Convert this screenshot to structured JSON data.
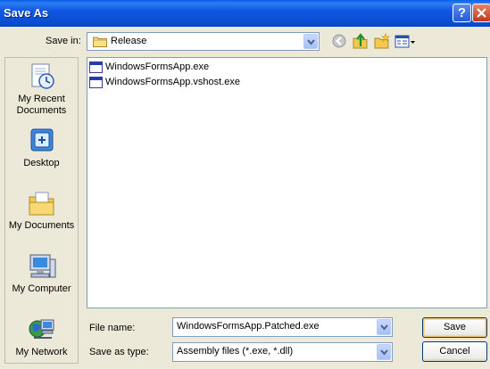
{
  "titlebar": {
    "title": "Save As",
    "help": "?"
  },
  "save_in": {
    "label": "Save in:",
    "value": "Release"
  },
  "toolbar": {
    "icons": [
      "back-icon",
      "up-one-level-icon",
      "new-folder-icon",
      "views-menu-icon"
    ]
  },
  "places": [
    {
      "label": "My Recent Documents",
      "icon": "my-recent-documents-icon"
    },
    {
      "label": "Desktop",
      "icon": "desktop-icon"
    },
    {
      "label": "My Documents",
      "icon": "my-documents-icon"
    },
    {
      "label": "My Computer",
      "icon": "my-computer-icon"
    },
    {
      "label": "My Network",
      "icon": "my-network-icon"
    }
  ],
  "files": [
    {
      "name": "WindowsFormsApp.exe"
    },
    {
      "name": "WindowsFormsApp.vshost.exe"
    }
  ],
  "file_name": {
    "label": "File name:",
    "value": "WindowsFormsApp.Patched.exe"
  },
  "save_as_type": {
    "label": "Save as type:",
    "value": "Assembly files (*.exe, *.dll)"
  },
  "buttons": {
    "save": "Save",
    "cancel": "Cancel"
  },
  "colors": {
    "title_bar": "#0a4fd6",
    "dialog_bg": "#ece9d8",
    "close_button": "#c2371a"
  }
}
